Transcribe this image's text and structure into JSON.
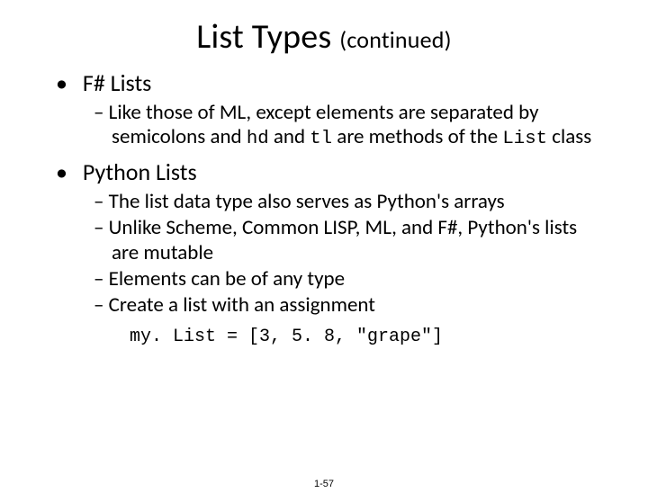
{
  "title": {
    "main": "List Types",
    "sub": "(continued)"
  },
  "bullets": [
    {
      "label": "F# Lists",
      "sub": [
        {
          "segments": [
            {
              "t": "Like those of ML, except elements are separated by semicolons and "
            },
            {
              "t": "hd",
              "mono": true
            },
            {
              "t": " and "
            },
            {
              "t": "tl",
              "mono": true
            },
            {
              "t": " are methods of the "
            },
            {
              "t": "List",
              "mono": true
            },
            {
              "t": " class"
            }
          ]
        }
      ]
    },
    {
      "label": "Python Lists",
      "sub": [
        {
          "text": "The list data type also serves as Python's arrays"
        },
        {
          "text": "Unlike Scheme, Common LISP, ML, and F#, Python's lists are mutable"
        },
        {
          "text": "Elements can be of any type"
        },
        {
          "text": "Create a list with an assignment"
        }
      ]
    }
  ],
  "code": "my. List = [3, 5. 8, \"grape\"]",
  "footer": "1-57"
}
